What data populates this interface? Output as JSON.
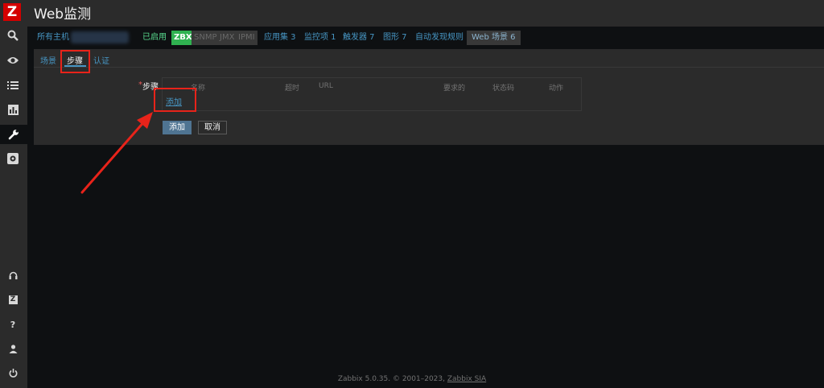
{
  "app": {
    "logo_letter": "Z",
    "page_title": "Web监测"
  },
  "sidebar": {
    "top_icons": [
      "search-icon",
      "eye-icon",
      "list-icon",
      "bar-chart-icon",
      "wrench-icon",
      "gear-icon"
    ],
    "bottom_icons": [
      "headset-icon",
      "zabbix-share-icon",
      "help-icon",
      "user-icon",
      "power-icon"
    ],
    "help_glyph": "?",
    "share_glyph": "Z"
  },
  "host_nav": {
    "all_hosts": "所有主机",
    "enabled": "已启用",
    "zbx": "ZBX",
    "snmp": "SNMP",
    "jmx": "JMX",
    "ipmi": "IPMI",
    "applications": "应用集 3",
    "items": "监控项 1",
    "triggers": "触发器 7",
    "graphs": "图形 7",
    "discovery": "自动发现规则",
    "web_scenarios": "Web 场景 6"
  },
  "tabs": {
    "scenario": "场景",
    "steps": "步骤",
    "auth": "认证"
  },
  "form": {
    "required_mark": "*",
    "steps_label": "步骤",
    "columns": {
      "name": "名称",
      "timeout": "超时",
      "url": "URL",
      "required": "要求的",
      "status_codes": "状态码",
      "action": "动作"
    },
    "add_link": "添加",
    "add_button": "添加",
    "cancel_button": "取消"
  },
  "footer": {
    "text": "Zabbix 5.0.35. © 2001–2023, ",
    "vendor": "Zabbix SIA"
  },
  "colors": {
    "accent": "#4796c4",
    "annotation": "#e8231a",
    "enabled": "#59db8f",
    "zbx_tag": "#30b251",
    "brand": "#d40000"
  }
}
